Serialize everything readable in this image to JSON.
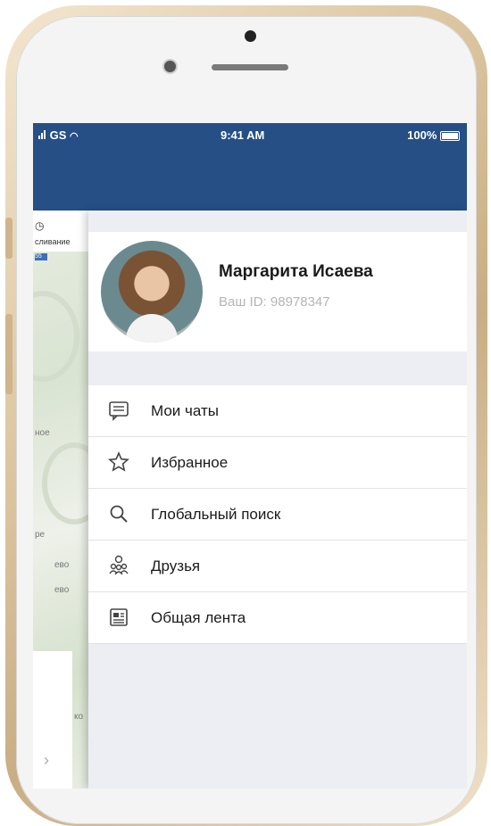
{
  "status_bar": {
    "carrier": "GS",
    "time": "9:41 AM",
    "battery": "100%"
  },
  "map_strip": {
    "top_label": "сливание",
    "road_tag": "55",
    "places": [
      "ное",
      "ре",
      "ево",
      "ево",
      "ко"
    ]
  },
  "profile": {
    "name": "Маргарита Исаева",
    "user_id": "Ваш ID: 98978347"
  },
  "menu": [
    {
      "label": "Мои чаты",
      "icon": "chat-icon"
    },
    {
      "label": "Избранное",
      "icon": "star-icon"
    },
    {
      "label": "Глобальный поиск",
      "icon": "search-icon"
    },
    {
      "label": "Друзья",
      "icon": "friends-icon"
    },
    {
      "label": "Общая лента",
      "icon": "news-feed-icon"
    }
  ],
  "colors": {
    "header": "#254f85",
    "drawer_bg": "#eceef3"
  }
}
